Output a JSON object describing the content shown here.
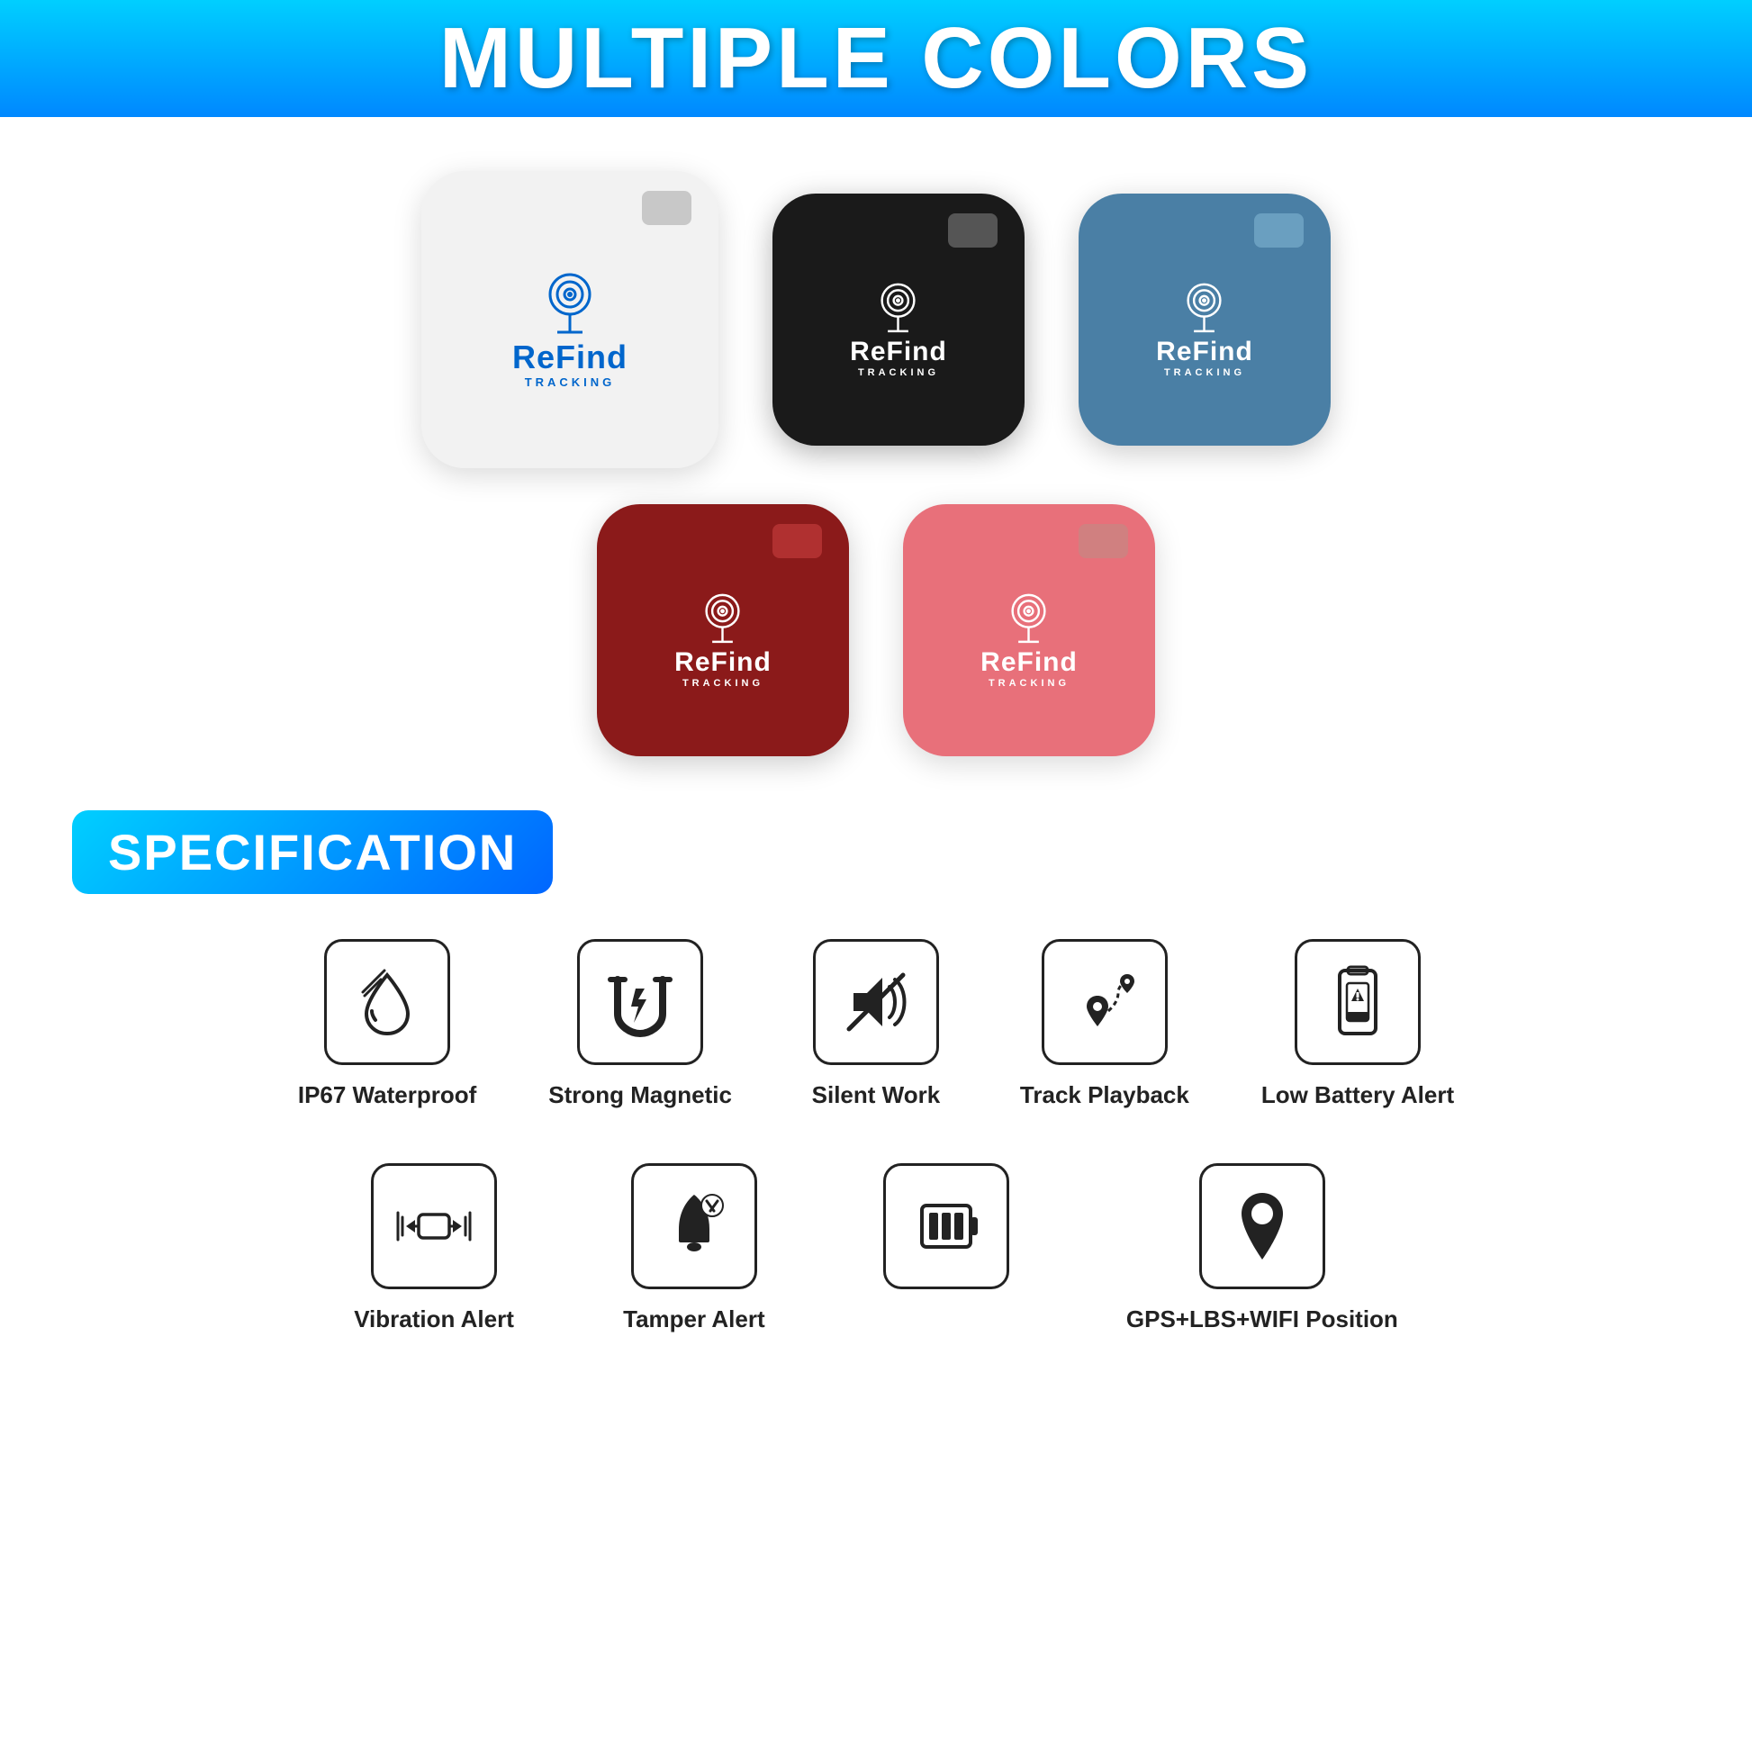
{
  "header": {
    "title": "MULTIPLE COLORS"
  },
  "trackers": {
    "row1": [
      {
        "id": "white",
        "color_class": "tracker-white",
        "btn_class": "btn-white-tracker",
        "text_class": "text-blue",
        "size": "large"
      },
      {
        "id": "black",
        "color_class": "tracker-black",
        "btn_class": "btn-black-tracker",
        "text_class": "text-white",
        "size": "medium"
      },
      {
        "id": "blue",
        "color_class": "tracker-blue",
        "btn_class": "btn-blue-tracker",
        "text_class": "text-white",
        "size": "medium"
      }
    ],
    "row2": [
      {
        "id": "red",
        "color_class": "tracker-red",
        "btn_class": "btn-red-tracker",
        "text_class": "text-white",
        "size": "medium"
      },
      {
        "id": "pink",
        "color_class": "tracker-pink",
        "btn_class": "btn-pink-tracker",
        "text_class": "text-white",
        "size": "medium"
      }
    ],
    "brand_name": "ReFind",
    "brand_sub": "TRACKING"
  },
  "specification": {
    "badge_label": "SPECIFICATION",
    "features_row1": [
      {
        "id": "waterproof",
        "label": "IP67 Waterproof"
      },
      {
        "id": "magnetic",
        "label": "Strong Magnetic"
      },
      {
        "id": "silent",
        "label": "Silent Work"
      },
      {
        "id": "track",
        "label": "Track Playback"
      },
      {
        "id": "battery_alert",
        "label": "Low Battery Alert"
      }
    ],
    "features_row2": [
      {
        "id": "vibration",
        "label": "Vibration Alert"
      },
      {
        "id": "tamper",
        "label": "Tamper Alert"
      },
      {
        "id": "battery_full",
        "label": ""
      },
      {
        "id": "gps",
        "label": "GPS+LBS+WIFI Position"
      }
    ]
  }
}
